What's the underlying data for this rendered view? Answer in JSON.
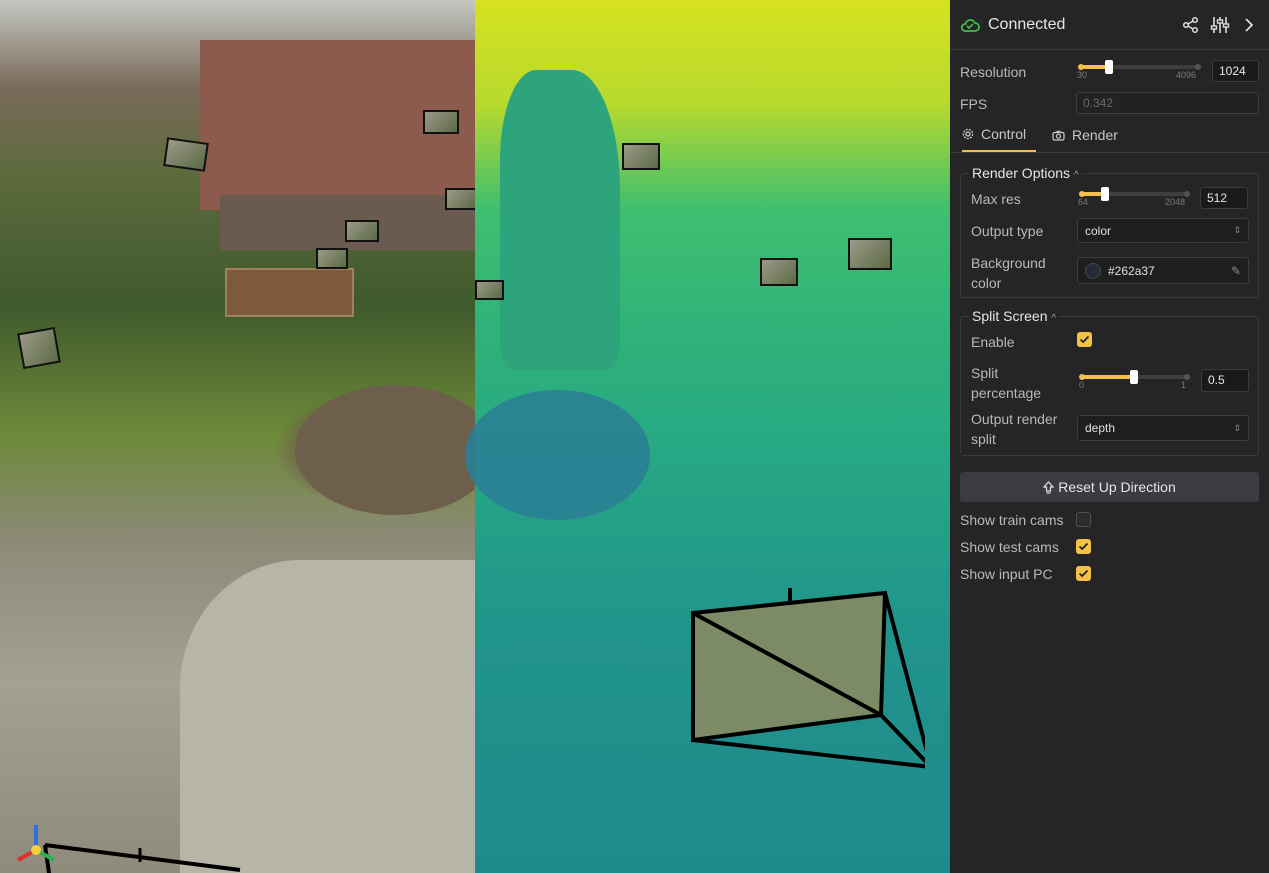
{
  "header": {
    "status": "Connected",
    "icons": [
      "cloud-icon",
      "share-icon",
      "sliders-icon",
      "chevron-right-icon"
    ],
    "accent": "#f4c24b",
    "status_color": "#3fbf4f"
  },
  "resolution": {
    "label": "Resolution",
    "value": "1024",
    "min": "30",
    "max": "4096",
    "fraction": 0.24
  },
  "fps": {
    "label": "FPS",
    "value": "0.342"
  },
  "tabs": [
    {
      "label": "Control",
      "icon": "gear-icon",
      "active": true
    },
    {
      "label": "Render",
      "icon": "camera-icon",
      "active": false
    }
  ],
  "render_options": {
    "title": "Render Options",
    "max_res": {
      "label": "Max res",
      "value": "512",
      "min": "64",
      "max": "2048",
      "fraction": 0.23
    },
    "output_type": {
      "label": "Output type",
      "value": "color"
    },
    "background_color": {
      "label_line1": "Background",
      "label_line2": "color",
      "value": "#262a37"
    }
  },
  "split_screen": {
    "title": "Split Screen",
    "enable": {
      "label": "Enable",
      "checked": true
    },
    "split_percentage": {
      "label_line1": "Split",
      "label_line2": "percentage",
      "value": "0.5",
      "min": "0",
      "max": "1",
      "fraction": 0.5
    },
    "output_render_split": {
      "label_line1": "Output render",
      "label_line2": "split",
      "value": "depth"
    }
  },
  "reset_button": "Reset Up Direction",
  "toggles": [
    {
      "label": "Show train cams",
      "checked": false
    },
    {
      "label": "Show test cams",
      "checked": true
    },
    {
      "label": "Show input PC",
      "checked": true
    }
  ]
}
